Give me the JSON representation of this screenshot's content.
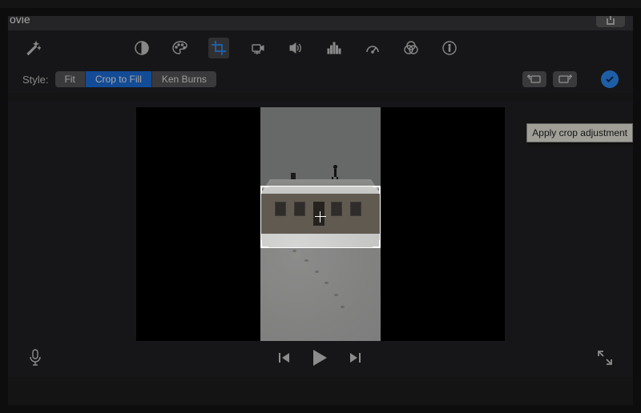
{
  "title": "ovie",
  "toolbar_icons": {
    "wand": "magic-wand-icon",
    "tools": [
      "contrast-icon",
      "color-palette-icon",
      "crop-icon",
      "camera-stabilize-icon",
      "volume-icon",
      "equalizer-icon",
      "speed-gauge-icon",
      "color-filter-icon",
      "info-icon"
    ],
    "active_tool": "crop-icon"
  },
  "style": {
    "label": "Style:",
    "options": [
      "Fit",
      "Crop to Fill",
      "Ken Burns"
    ],
    "selected": "Crop to Fill"
  },
  "rotate": {
    "ccw": "rotate-ccw-icon",
    "cw": "rotate-cw-icon"
  },
  "apply": {
    "tooltip": "Apply crop adjustment"
  },
  "controls": {
    "mic": "microphone-icon",
    "prev": "previous-icon",
    "play": "play-icon",
    "next": "next-icon",
    "fullscreen": "fullscreen-icon"
  },
  "share": {
    "icon": "share-icon"
  },
  "colors": {
    "accent": "#2f91ff"
  }
}
